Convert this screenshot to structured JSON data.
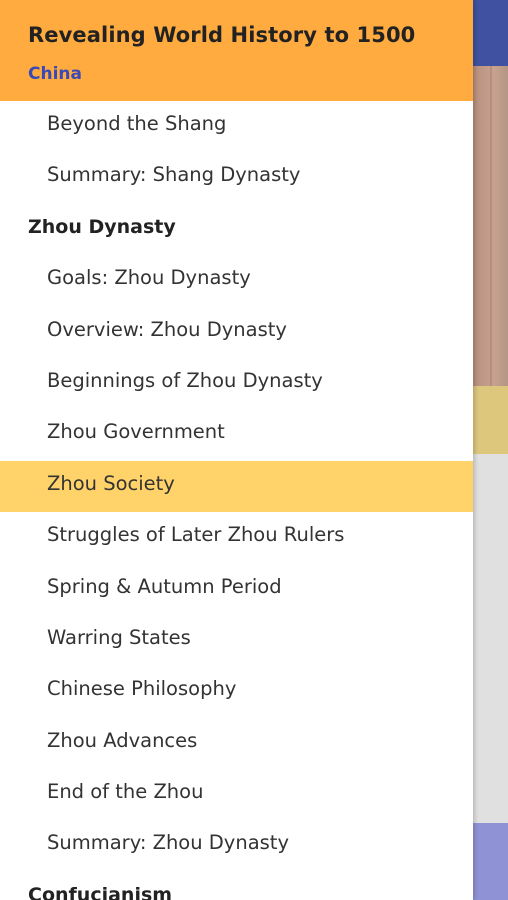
{
  "header": {
    "title": "Revealing World History to 1500",
    "subtitle": "China"
  },
  "nav": {
    "items": [
      {
        "label": "Beyond the Shang",
        "type": "item"
      },
      {
        "label": "Summary: Shang Dynasty",
        "type": "item"
      },
      {
        "label": "Zhou Dynasty",
        "type": "section"
      },
      {
        "label": "Goals: Zhou Dynasty",
        "type": "item"
      },
      {
        "label": "Overview: Zhou Dynasty",
        "type": "item"
      },
      {
        "label": "Beginnings of Zhou Dynasty",
        "type": "item"
      },
      {
        "label": "Zhou Government",
        "type": "item"
      },
      {
        "label": "Zhou Society",
        "type": "item",
        "selected": true
      },
      {
        "label": "Struggles of Later Zhou Rulers",
        "type": "item"
      },
      {
        "label": "Spring & Autumn Period",
        "type": "item"
      },
      {
        "label": "Warring States",
        "type": "item"
      },
      {
        "label": "Chinese Philosophy",
        "type": "item"
      },
      {
        "label": "Zhou Advances",
        "type": "item"
      },
      {
        "label": "End of the Zhou",
        "type": "item"
      },
      {
        "label": "Summary: Zhou Dynasty",
        "type": "item"
      },
      {
        "label": "Confucianism",
        "type": "section"
      }
    ]
  },
  "colors": {
    "header_bg": "#ffab40",
    "subtitle": "#3a49b6",
    "selected_bg": "#ffd36a",
    "background_app_bar": "#3f51a0"
  }
}
